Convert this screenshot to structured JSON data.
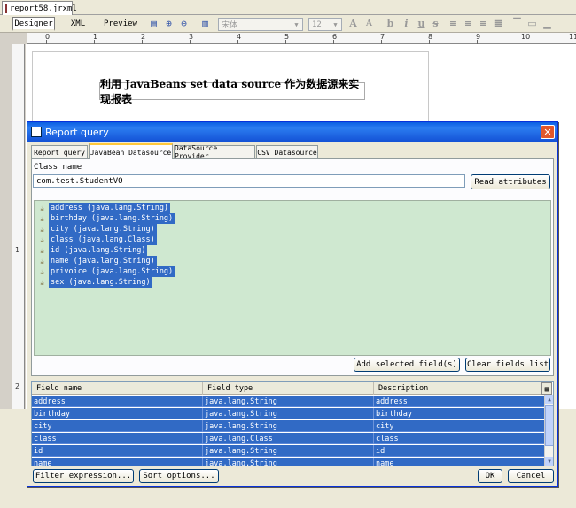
{
  "file_tab": {
    "label": "report58.jrxml"
  },
  "view_tabs": [
    "Designer",
    "XML",
    "Preview"
  ],
  "toolbar": {
    "font_name": "宋体",
    "font_size": "12",
    "icons": [
      "zoom-page-icon",
      "zoom-in-icon",
      "zoom-out-icon",
      "align-icon",
      "increase-font-icon",
      "decrease-font-icon",
      "bold-icon",
      "italic-icon",
      "underline-icon",
      "strike-icon",
      "align-left-icon",
      "align-center-icon",
      "align-right-icon",
      "justify-icon",
      "align-top-icon",
      "align-middle-icon",
      "align-bottom-icon"
    ]
  },
  "ruler": {
    "h_labels": [
      "0",
      "1",
      "2",
      "3",
      "4",
      "5",
      "6",
      "7",
      "8",
      "9",
      "10",
      "11"
    ],
    "v_labels": [
      "1",
      "2"
    ]
  },
  "report": {
    "title": "利用 JavaBeans set data source 作为数据源来实现报表"
  },
  "dialog": {
    "title": "Report query",
    "close_symbol": "✕",
    "tabs": [
      "Report query",
      "JavaBean Datasource",
      "DataSource Provider",
      "CSV Datasource"
    ],
    "active_tab": 1,
    "class_name_label": "Class name",
    "class_name_value": "com.test.StudentVO",
    "read_attributes_label": "Read attributes",
    "attributes": [
      "address (java.lang.String)",
      "birthday (java.lang.String)",
      "city (java.lang.String)",
      "class (java.lang.Class)",
      "id (java.lang.String)",
      "name (java.lang.String)",
      "privoice (java.lang.String)",
      "sex (java.lang.String)"
    ],
    "add_selected_label": "Add selected field(s)",
    "clear_fields_label": "Clear fields list",
    "table": {
      "columns": [
        "Field name",
        "Field type",
        "Description"
      ],
      "rows": [
        [
          "address",
          "java.lang.String",
          "address"
        ],
        [
          "birthday",
          "java.lang.String",
          "birthday"
        ],
        [
          "city",
          "java.lang.String",
          "city"
        ],
        [
          "class",
          "java.lang.Class",
          "class"
        ],
        [
          "id",
          "java.lang.String",
          "id"
        ],
        [
          "name",
          "java.lang.String",
          "name"
        ]
      ]
    },
    "filter_label": "Filter expression...",
    "sort_label": "Sort options...",
    "ok_label": "OK",
    "cancel_label": "Cancel"
  },
  "colors": {
    "selection": "#316ac5",
    "titlebar": "#0a5fe3",
    "attr_bg": "#cfe8d0"
  }
}
